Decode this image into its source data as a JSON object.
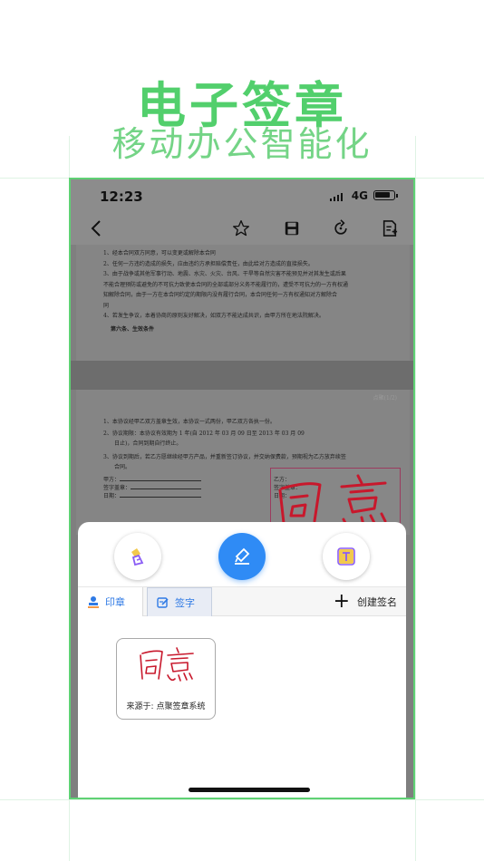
{
  "promo": {
    "headline": "电子签章",
    "subline": "移动办公智能化"
  },
  "status_bar": {
    "time": "12:23",
    "network": "4G"
  },
  "nav_bar": {
    "icons": [
      "back-icon",
      "star-icon",
      "save-icon",
      "rotate-icon",
      "note-icon"
    ]
  },
  "document": {
    "page1_lines": [
      "1、经本合同双方同意，可以变更或解除本合同",
      "2、任何一方违约造成的损失，应由违约方承担赔偿责任，由此给对方造成的直接损失。",
      "3、由于战争或其他军事行动、地震、水灾、火灾、台风、干旱等自然灾害不能预见并对其发生或后果",
      "不能合理预防或避免的不可抗力致使本合同的全部或部分义务不能履行的，遭受不可抗力的一方有权通",
      "知解除合同，由于一方在本合同约定的期限内没有履行合同，本合同任何一方有权通知对方解除合",
      "同",
      "4、若发生争议，本着协商的原则友好解决，如双方不能达成共识，由甲方所在地法院解决。"
    ],
    "page1_section": "第六条、生效条件",
    "page2_lines": [
      "1、本协议经甲乙双方盖章生效，本协议一式两份，甲乙双方各执一份。",
      "2、协议期限：本协议有效期为 1 年(自 2012 年 03 月 09 日至 2013 年 03 月 09",
      "日止)，合同到期自行终止。",
      "3、协议到期后，若乙方愿继续经甲方产品，并重新签订协议，并交纳保费款，预期视为乙方放弃续签",
      "合同。"
    ],
    "page_num": "点聚(1/2)",
    "party_a": "甲方：",
    "party_a_seal": "签字盖章：",
    "party_a_date": "日期：",
    "party_b": "乙方：",
    "party_b_seal": "签字盖章：",
    "party_b_date": "日期："
  },
  "sheet": {
    "tools": [
      "seal-stamp-icon",
      "handwrite-sign-icon",
      "text-box-icon"
    ],
    "tab_seal": "印章",
    "tab_sign": "签字",
    "create_signature": "创建签名",
    "card_caption": "来源于: 点聚签章系统"
  },
  "colors": {
    "brand_green": "#52cf6c",
    "accent_blue": "#2f8bf5",
    "signature_red": "#c8182c"
  }
}
